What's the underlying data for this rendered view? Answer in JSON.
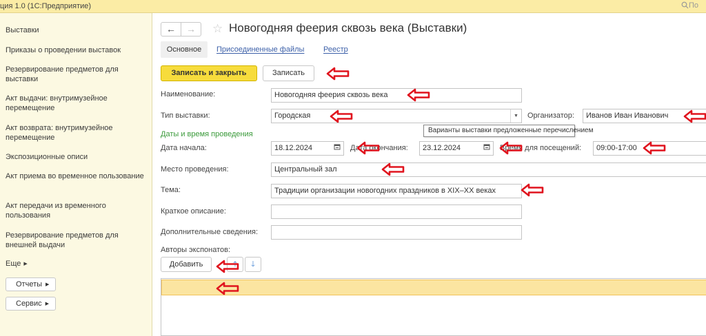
{
  "app": {
    "title": "ция 1.0  (1С:Предприятие)",
    "search_placeholder": "По"
  },
  "sidebar": {
    "items": [
      {
        "label": "Выставки"
      },
      {
        "label": "Приказы о проведении выставок"
      },
      {
        "label": "Резервирование предметов для выставки"
      },
      {
        "label": "Акт выдачи: внутримузейное перемещение"
      },
      {
        "label": "Акт возврата: внутримузейное перемещение"
      },
      {
        "label": "Экспозиционные описи"
      },
      {
        "label": "Акт приема во временное пользование"
      },
      {
        "label": "Акт передачи из временного пользования"
      },
      {
        "label": "Резервирование предметов для внешней выдачи"
      }
    ],
    "more_label": "Еще",
    "reports_label": "Отчеты",
    "service_label": "Сервис"
  },
  "form": {
    "title": "Новогодняя феерия сквозь века (Выставки)",
    "tabs": [
      "Основное",
      "Присоединенные файлы",
      "Реестр"
    ],
    "buttons": {
      "save_close": "Записать и закрыть",
      "save": "Записать"
    },
    "fields": {
      "name_label": "Наименование:",
      "name_value": "Новогодняя феерия сквозь века",
      "type_label": "Тип выставки:",
      "type_value": "Городская",
      "organizer_label": "Организатор:",
      "organizer_value": "Иванов Иван Иванович",
      "dates_group": "Даты и время проведения",
      "start_label": "Дата начала:",
      "start_value": "18.12.2024",
      "end_label": "Дата окончания:",
      "end_value": "23.12.2024",
      "visit_label": "Время для посещений:",
      "visit_value": "09:00-17:00",
      "place_label": "Место проведения:",
      "place_value": "Центральный зал",
      "theme_label": "Тема:",
      "theme_value": "Традиции организации новогодних праздников в XIX–XX веках",
      "short_label": "Краткое описание:",
      "short_value": "",
      "extra_label": "Дополнительные сведения:",
      "extra_value": ""
    },
    "tooltip": "Варианты выставки предложенные перечислением",
    "authors_label": "Авторы экспонатов:",
    "add_label": "Добавить"
  },
  "colors": {
    "topbar": "#fbeca5",
    "sidebar": "#fcf9e2",
    "primary_button": "#f7dc3c",
    "selected_row": "#fbe5a1",
    "annotation_arrow": "#e0141e",
    "link": "#3b5fa8",
    "group_label": "#3a9a3a"
  },
  "icons": {
    "back": "arrow-left-icon",
    "forward": "arrow-right-icon",
    "favorite": "star-icon",
    "calendar": "calendar-icon",
    "dropdown": "dropdown-icon",
    "move_up": "arrow-up-icon",
    "move_down": "arrow-down-icon",
    "search": "search-icon",
    "annotation": "red-arrow-icon"
  }
}
